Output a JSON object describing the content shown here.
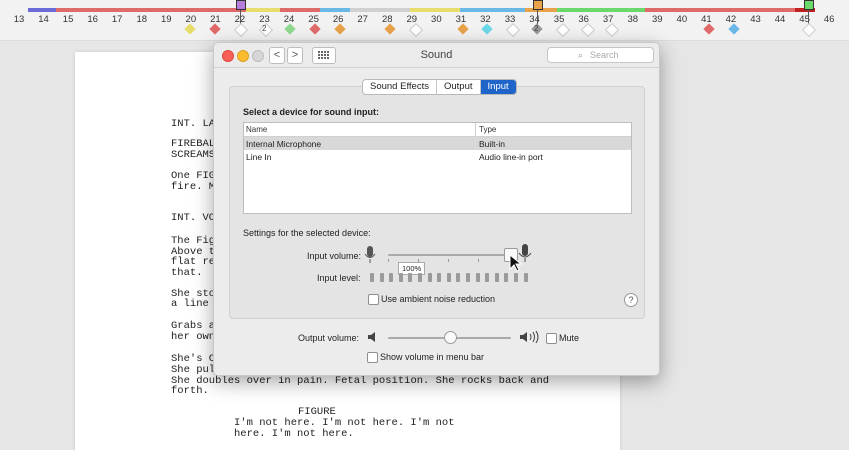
{
  "timeline": {
    "numbers": [
      "13",
      "14",
      "15",
      "16",
      "17",
      "18",
      "19",
      "20",
      "21",
      "22",
      "23",
      "24",
      "25",
      "26",
      "27",
      "28",
      "29",
      "30",
      "31",
      "32",
      "33",
      "34",
      "35",
      "36",
      "37",
      "38",
      "39",
      "40",
      "41",
      "42",
      "43",
      "44",
      "45",
      "46"
    ],
    "badges": [
      "2",
      "2"
    ]
  },
  "screenplay": {
    "lines": [
      "INT. LA",
      "FIREBAL",
      "SCREAMS",
      "One FIG",
      "fire. M",
      "INT. VO",
      "The Fig",
      "Above t",
      "flat re",
      "that.",
      "She sto",
      "a line",
      "Grabs a",
      "her own",
      "She's C",
      "She pul",
      "She doubles over in pain. Fetal position. She rocks back and",
      "forth.",
      "FIGURE",
      "I'm not here. I'm not here. I'm not",
      "here. I'm not here."
    ]
  },
  "window": {
    "title": "Sound",
    "search_placeholder": "Search",
    "nav_back": "<",
    "nav_forward": ">",
    "grid_icon": "grid-icon",
    "tabs": [
      "Sound Effects",
      "Output",
      "Input"
    ],
    "active_tab": "Input",
    "select_label": "Select a device for sound input:",
    "columns": [
      "Name",
      "Type"
    ],
    "devices": [
      {
        "name": "Internal Microphone",
        "type": "Built-in",
        "selected": true
      },
      {
        "name": "Line In",
        "type": "Audio line-in port",
        "selected": false
      }
    ],
    "settings_label": "Settings for the selected device:",
    "input_volume_label": "Input volume:",
    "input_volume_value": "100%",
    "input_volume_level": 1.0,
    "input_level_label": "Input level:",
    "ambient_label": "Use ambient noise reduction",
    "ambient_checked": false,
    "help": "?",
    "output_volume_label": "Output volume:",
    "output_volume_level": 0.5,
    "mute_label": "Mute",
    "mute_checked": false,
    "show_volume_label": "Show volume in menu bar",
    "show_volume_checked": false
  }
}
